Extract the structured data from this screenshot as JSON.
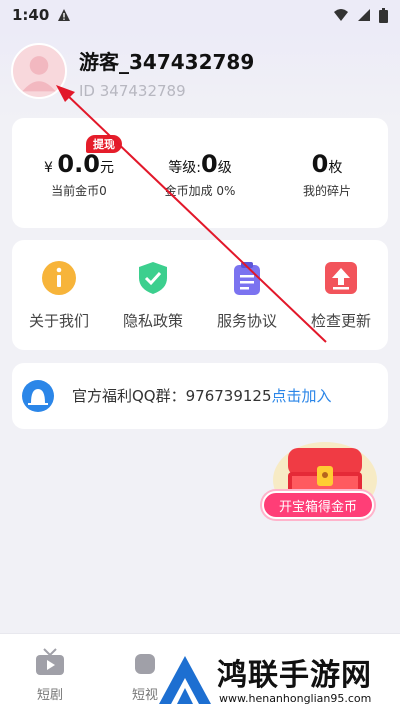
{
  "status": {
    "time": "1:40"
  },
  "profile": {
    "username": "游客_347432789",
    "id_text": "ID 347432789"
  },
  "stats": {
    "withdraw_badge": "提现",
    "coins_prefix": "¥",
    "coins_value": "0.0",
    "coins_unit": "元",
    "coins_label": "当前金币0",
    "level_prefix": "等级:",
    "level_value": "0",
    "level_unit": "级",
    "level_label": "金币加成 0%",
    "fragments_value": "0",
    "fragments_unit": "枚",
    "fragments_label": "我的碎片"
  },
  "menu": {
    "items": [
      {
        "label": "关于我们",
        "icon": "info-icon",
        "color": "#f7b43a"
      },
      {
        "label": "隐私政策",
        "icon": "shield-check-icon",
        "color": "#3ccf8e"
      },
      {
        "label": "服务协议",
        "icon": "clipboard-icon",
        "color": "#7b73f0"
      },
      {
        "label": "检查更新",
        "icon": "upload-icon",
        "color": "#f2545b"
      }
    ]
  },
  "qq_group": {
    "text": "官方福利QQ群：976739125",
    "join": "点击加入"
  },
  "treasure": {
    "button": "开宝箱得金币"
  },
  "bottom_nav": {
    "items": [
      {
        "label": "短剧"
      },
      {
        "label": "短视"
      }
    ]
  },
  "watermark": {
    "title": "鸿联手游网",
    "url": "www.henanhonglian95.com"
  },
  "colors": {
    "accent_red": "#e51d2a",
    "link_blue": "#2b86e8",
    "treasure_pink": "#ff3e77"
  }
}
